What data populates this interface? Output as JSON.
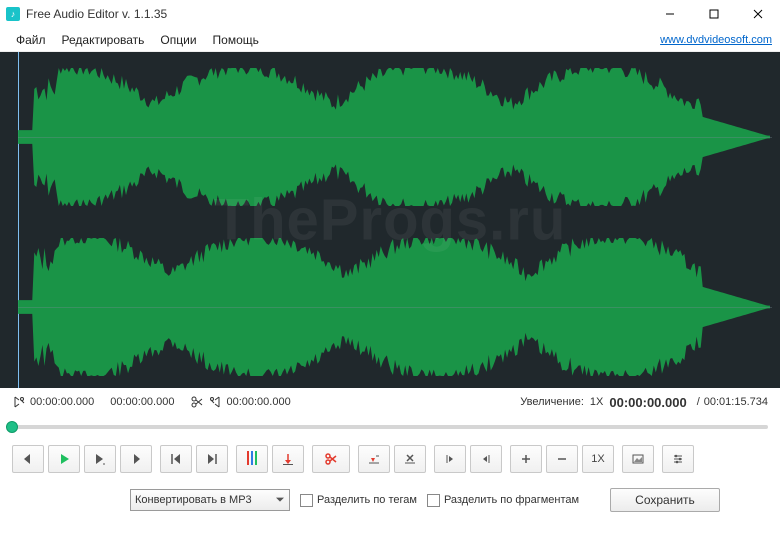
{
  "window": {
    "title": "Free Audio Editor v. 1.1.35",
    "minimize_tip": "Minimize",
    "maximize_tip": "Maximize",
    "close_tip": "Close"
  },
  "menu": {
    "file": "Файл",
    "edit": "Редактировать",
    "options": "Опции",
    "help": "Помощь",
    "site_link": "www.dvdvideosoft.com"
  },
  "watermark": "TheProgs.ru",
  "status": {
    "sel_start": "00:00:00.000",
    "sel_end": "00:00:00.000",
    "cut_time": "00:00:00.000",
    "zoom_label": "Увеличение:",
    "zoom_value": "1X",
    "position": "00:00:00.000",
    "duration": "00:01:15.734"
  },
  "toolbar": {
    "zoom_reset": "1X"
  },
  "bottom": {
    "convert_label": "Конвертировать в MP3",
    "split_tags": "Разделить по тегам",
    "split_fragments": "Разделить по фрагментам",
    "save": "Сохранить"
  },
  "colors": {
    "wave": "#1a9d4a",
    "bg": "#20282c",
    "accent_play": "#1fbf5f",
    "accent_cut": "#e33b2e"
  }
}
